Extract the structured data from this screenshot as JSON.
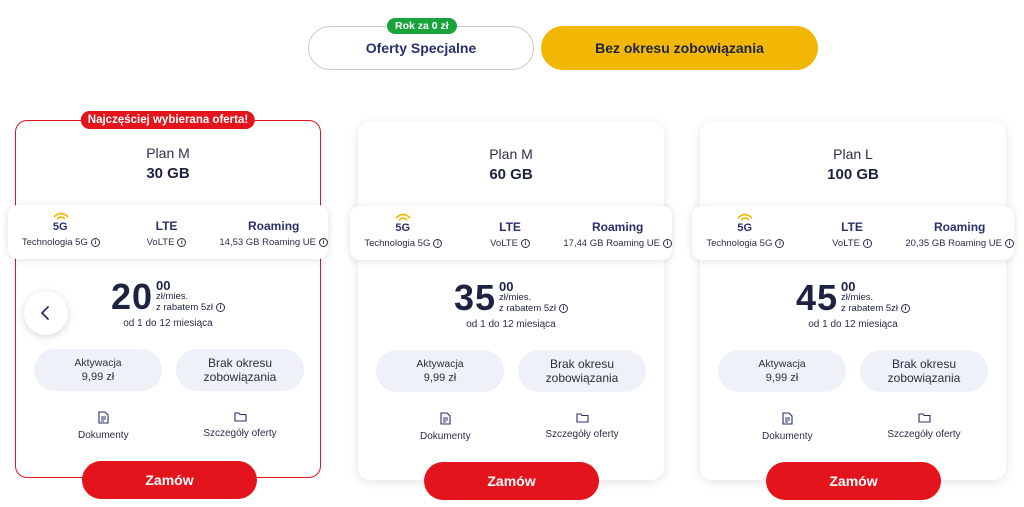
{
  "tabs": {
    "special": {
      "label": "Oferty Specjalne",
      "badge": "Rok za 0 zł"
    },
    "no_commitment": {
      "label": "Bez okresu zobowiązania",
      "active": true
    }
  },
  "plans": [
    {
      "featured_badge": "Najczęściej wybierana oferta!",
      "name": "Plan M",
      "data": "30 GB",
      "features": {
        "f5g_icon": "5G",
        "f5g_label": "Technologia 5G",
        "lte_title": "LTE",
        "lte_label": "VoLTE",
        "roaming_title": "Roaming",
        "roaming_label": "14,53 GB Roaming UE"
      },
      "price": {
        "main": "20",
        "cents": "00",
        "unit": "zł/mies.",
        "discount": "z rabatem 5zł",
        "period": "od 1 do 12 miesiąca"
      },
      "activation_label": "Aktywacja",
      "activation_value": "9,99 zł",
      "commitment": "Brak okresu zobowiązania",
      "docs_label": "Dokumenty",
      "details_label": "Szczegóły oferty",
      "order_label": "Zamów"
    },
    {
      "name": "Plan M",
      "data": "60 GB",
      "features": {
        "f5g_icon": "5G",
        "f5g_label": "Technologia 5G",
        "lte_title": "LTE",
        "lte_label": "VoLTE",
        "roaming_title": "Roaming",
        "roaming_label": "17,44 GB Roaming UE"
      },
      "price": {
        "main": "35",
        "cents": "00",
        "unit": "zł/mies.",
        "discount": "z rabatem 5zł",
        "period": "od 1 do 12 miesiąca"
      },
      "activation_label": "Aktywacja",
      "activation_value": "9,99 zł",
      "commitment": "Brak okresu zobowiązania",
      "docs_label": "Dokumenty",
      "details_label": "Szczegóły oferty",
      "order_label": "Zamów"
    },
    {
      "name": "Plan L",
      "data": "100 GB",
      "features": {
        "f5g_icon": "5G",
        "f5g_label": "Technologia 5G",
        "lte_title": "LTE",
        "lte_label": "VoLTE",
        "roaming_title": "Roaming",
        "roaming_label": "20,35 GB Roaming UE"
      },
      "price": {
        "main": "45",
        "cents": "00",
        "unit": "zł/mies.",
        "discount": "z rabatem 5zł",
        "period": "od 1 do 12 miesiąca"
      },
      "activation_label": "Aktywacja",
      "activation_value": "9,99 zł",
      "commitment": "Brak okresu zobowiązania",
      "docs_label": "Dokumenty",
      "details_label": "Szczegóły oferty",
      "order_label": "Zamów"
    }
  ],
  "colors": {
    "accent_red": "#e3141c",
    "active_tab": "#f2b705",
    "badge_green": "#19a33b",
    "navy": "#2a2f6b",
    "wifi_yellow": "#f2b705"
  },
  "icons": {
    "prev": "chevron-left-icon",
    "docs": "document-icon",
    "details": "folder-icon",
    "info": "info-icon",
    "signal": "wifi-icon"
  }
}
